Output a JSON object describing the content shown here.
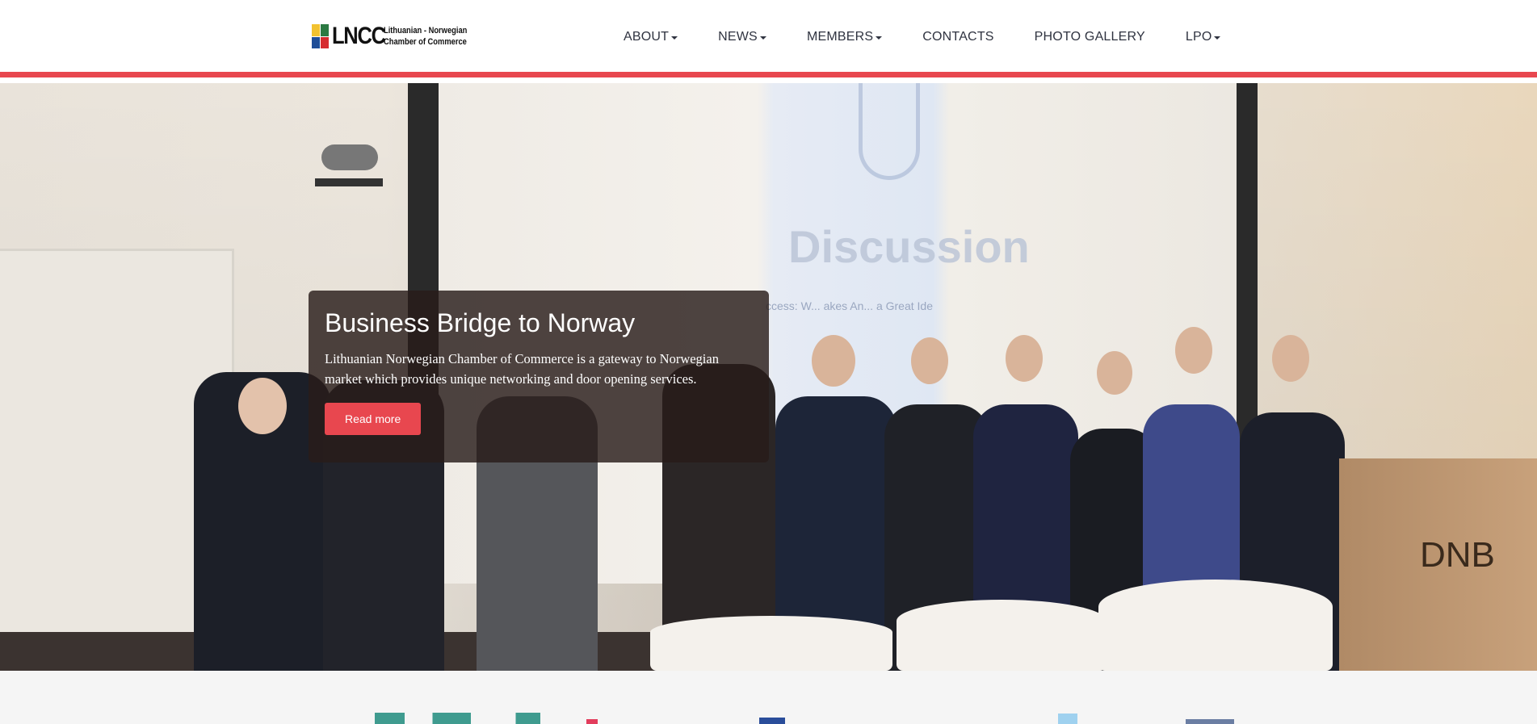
{
  "header": {
    "logo_text": "LNCC",
    "logo_sub_line1": "Lithuanian - Norwegian",
    "logo_sub_line2": "Chamber of Commerce",
    "accent_color": "#e8474f"
  },
  "nav": {
    "items": [
      {
        "label": "ABOUT",
        "dropdown": true
      },
      {
        "label": "NEWS",
        "dropdown": true
      },
      {
        "label": "MEMBERS",
        "dropdown": true
      },
      {
        "label": "CONTACTS",
        "dropdown": false
      },
      {
        "label": "PHOTO GALLERY",
        "dropdown": false
      },
      {
        "label": "LPO",
        "dropdown": true
      }
    ]
  },
  "hero": {
    "screen_text": "Discussion",
    "screen_subtext": "ccess: W... akes An... a Great Ide",
    "lectern_text": "DNB",
    "caption_title": "Business Bridge to Norway",
    "caption_text": "Lithuanian Norwegian Chamber of Commerce is a gateway to Norwegian market which provides unique networking and door opening services.",
    "button_label": "Read more"
  },
  "icons": {
    "caret": "caret-down-icon",
    "logo_mark": "lncc-logo-mark"
  }
}
